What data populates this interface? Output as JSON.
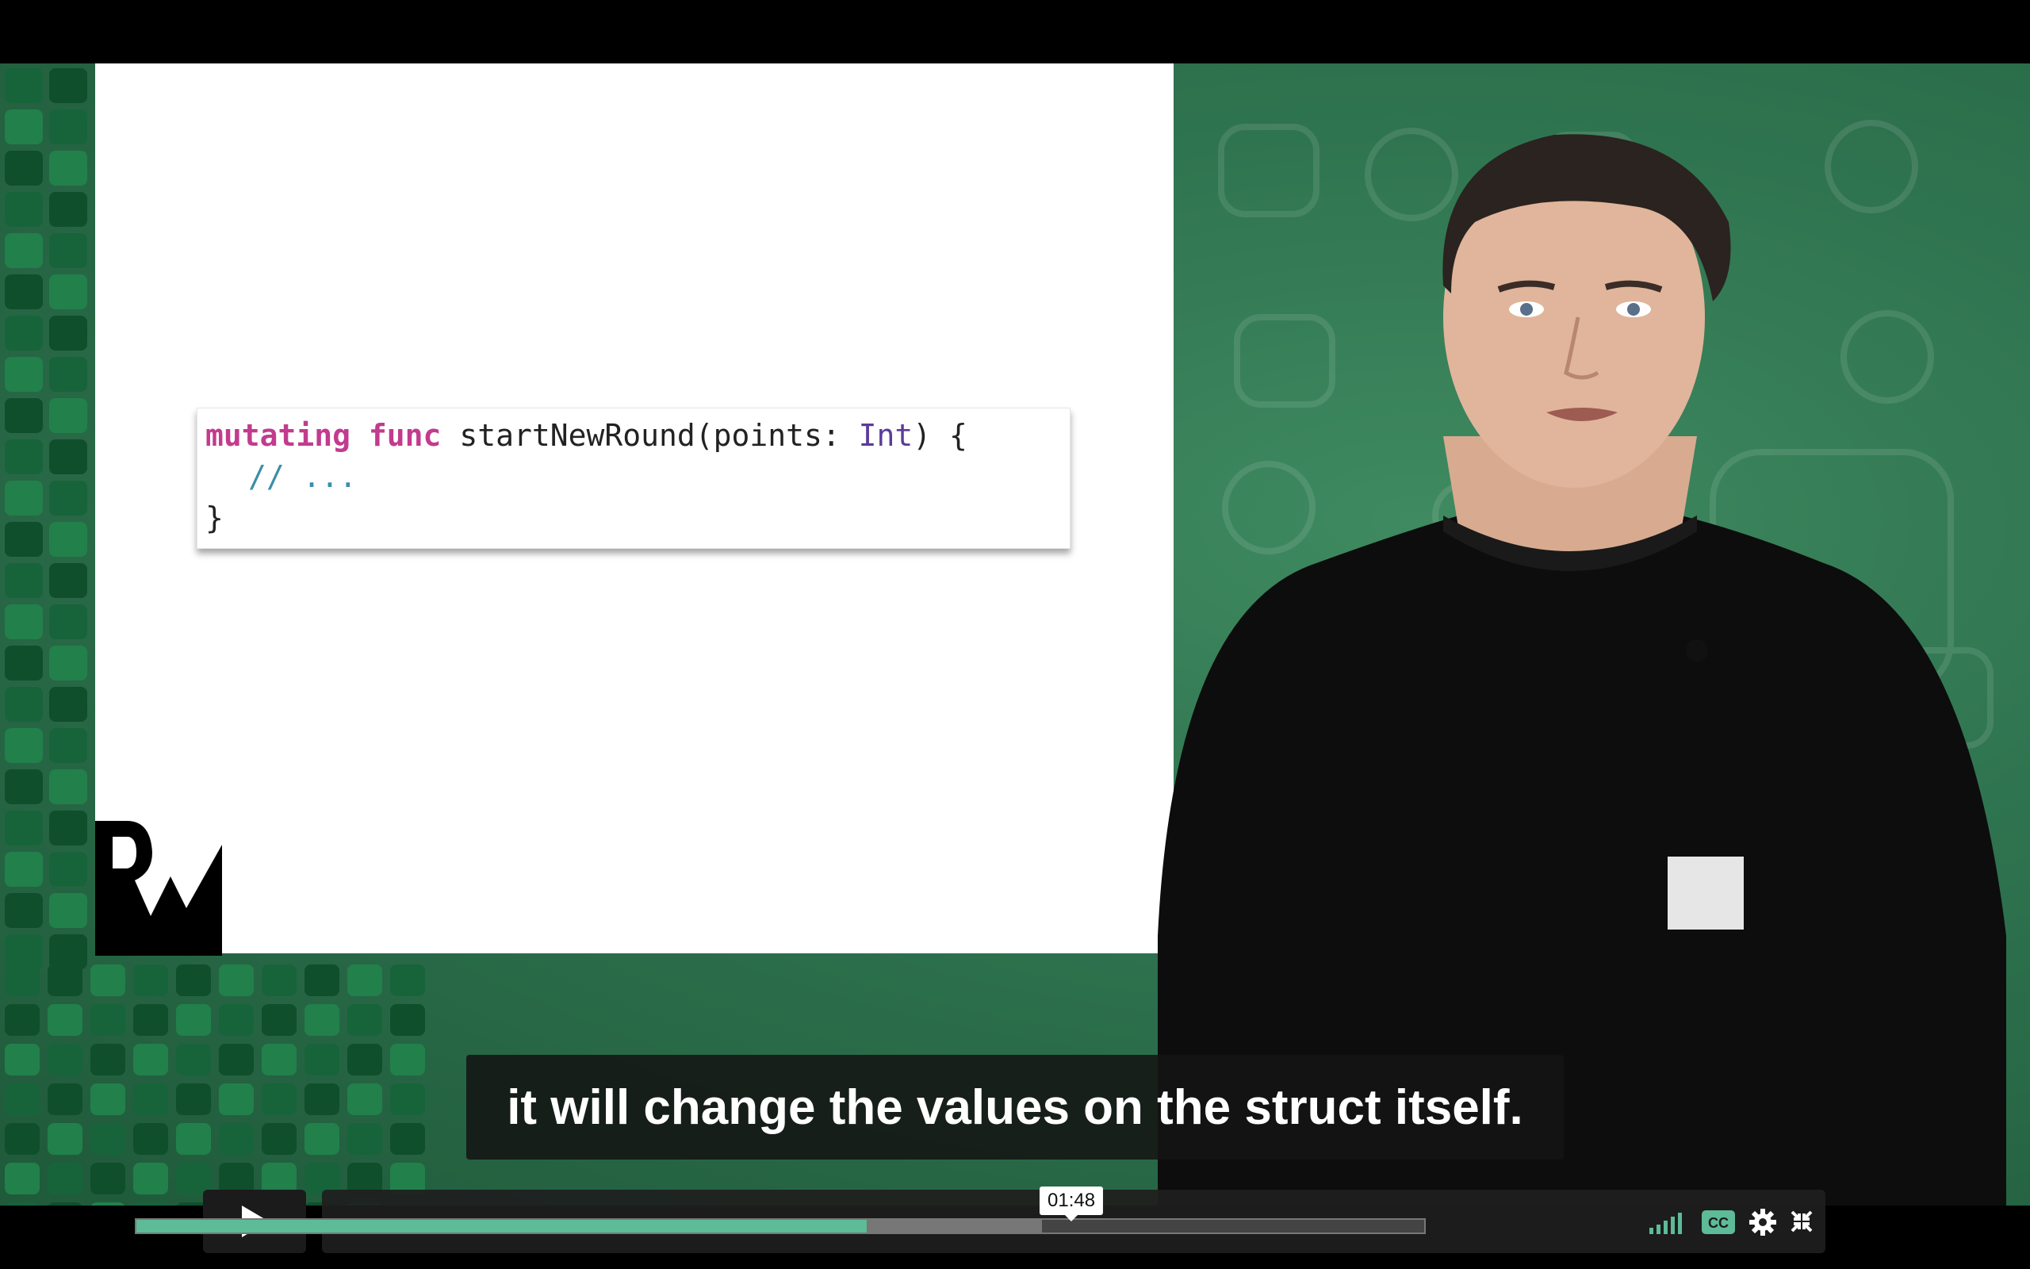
{
  "slide": {
    "code": {
      "line1": {
        "kw1": "mutating",
        "kw2": "func",
        "name": "startNewRound(points: ",
        "type": "Int",
        "end": ") {"
      },
      "line2": "// ...",
      "line3": "}"
    },
    "logo": "RW"
  },
  "subtitle": "it will change the values on the struct itself.",
  "player": {
    "current_time": "01:48",
    "progress": 0.567,
    "buffered": 0.703,
    "icons": [
      "play-icon",
      "volume-icon",
      "cc-icon",
      "settings-icon",
      "fullscreen-exit-icon"
    ],
    "colors": {
      "progress": "#5dbb97",
      "accent": "#2f7450"
    }
  }
}
